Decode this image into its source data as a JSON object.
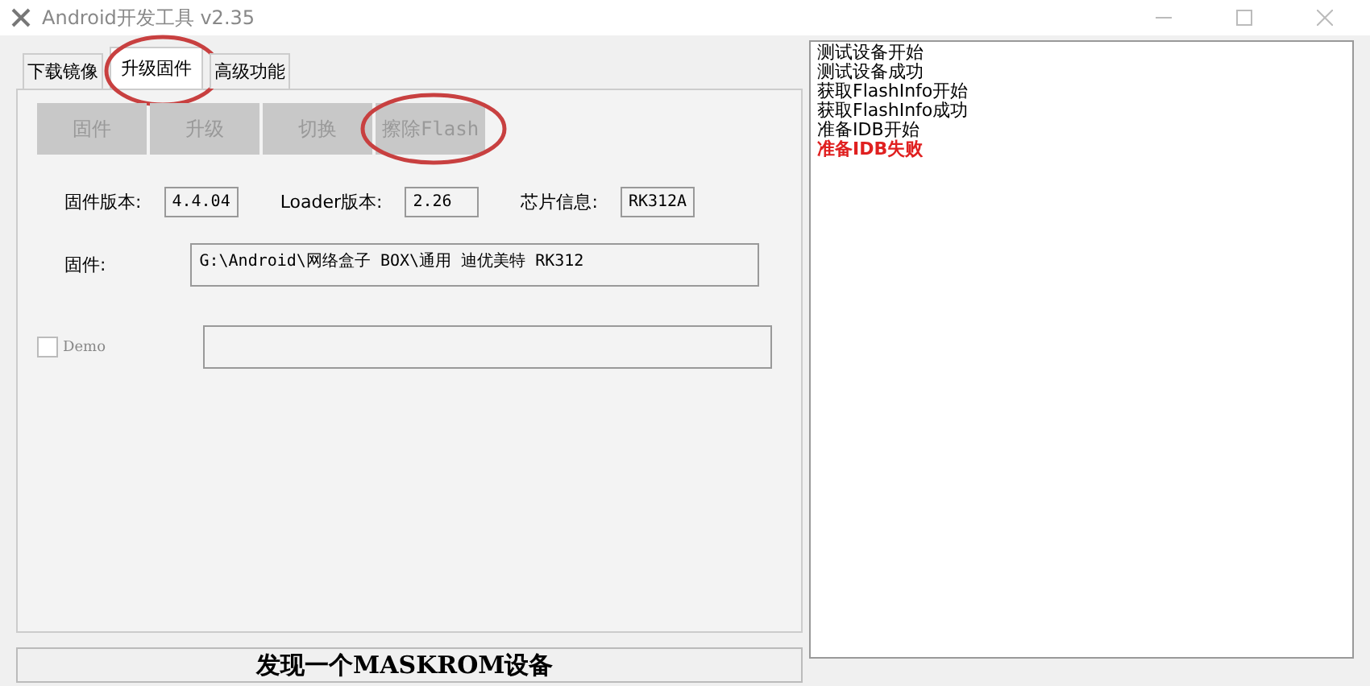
{
  "window": {
    "title": "Android开发工具 v2.35"
  },
  "tabs": [
    {
      "label": "下载镜像",
      "selected": false,
      "circled": false
    },
    {
      "label": "升级固件",
      "selected": true,
      "circled": true
    },
    {
      "label": "高级功能",
      "selected": false,
      "circled": false
    }
  ],
  "toolbar": [
    {
      "label": "固件",
      "disabled": true,
      "circled": false
    },
    {
      "label": "升级",
      "disabled": true,
      "circled": false
    },
    {
      "label": "切换",
      "disabled": true,
      "circled": false
    },
    {
      "label": "擦除Flash",
      "disabled": true,
      "circled": true
    }
  ],
  "info": [
    {
      "label": "固件版本:",
      "value": "4.4.04"
    },
    {
      "label": "Loader版本:",
      "value": "2.26"
    },
    {
      "label": "芯片信息:",
      "value": "RK312A"
    }
  ],
  "firmware": {
    "label": "固件:",
    "value": "G:\\Android\\网络盒子 BOX\\通用 迪优美特 RK312"
  },
  "demo": {
    "label": "Demo",
    "checked": false
  },
  "status_bar": "发现一个MASKROM设备",
  "log": [
    {
      "text": "测试设备开始",
      "error": false
    },
    {
      "text": "测试设备成功",
      "error": false
    },
    {
      "text": "获取FlashInfo开始",
      "error": false
    },
    {
      "text": "获取FlashInfo成功",
      "error": false
    },
    {
      "text": "准备IDB开始",
      "error": false
    },
    {
      "text": "准备IDB失败",
      "error": true
    }
  ]
}
